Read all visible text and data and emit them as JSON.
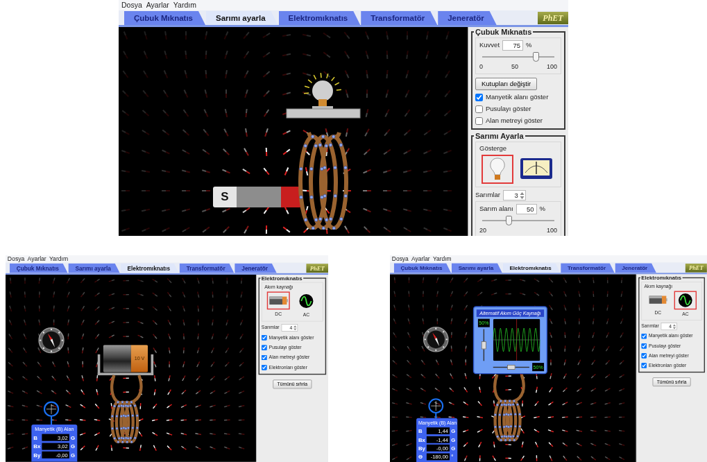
{
  "windows": [
    {
      "menu": [
        "Dosya",
        "Ayarlar",
        "Yardım"
      ],
      "tabs": [
        {
          "label": "Çubuk Mıknatıs",
          "selected": false
        },
        {
          "label": "Sarımı ayarla",
          "selected": true
        },
        {
          "label": "Elektromıknatıs",
          "selected": false
        },
        {
          "label": "Transformatör",
          "selected": false
        },
        {
          "label": "Jeneratör",
          "selected": false
        }
      ],
      "logo": "PhET",
      "scene": [
        {
          "kind": "field"
        },
        {
          "kind": "bulb"
        },
        {
          "kind": "magnet",
          "label": "S"
        },
        {
          "kind": "coil"
        }
      ],
      "panel": {
        "sections": [
          {
            "title": "Çubuk Mıknatıs",
            "controls": [
              {
                "kind": "slider",
                "label": "Kuvvet",
                "value": "75",
                "unit": "%",
                "level": 0.75,
                "ticks": [
                  "0",
                  "50",
                  "100"
                ]
              },
              {
                "kind": "button",
                "label": "Kutupları değiştir"
              },
              {
                "kind": "checkbox",
                "label": "Manyetik alanı göster",
                "checked": true
              },
              {
                "kind": "checkbox",
                "label": "Pusulayı göster",
                "checked": false
              },
              {
                "kind": "checkbox",
                "label": "Alan metreyi göster",
                "checked": false
              }
            ]
          },
          {
            "title": "Sarımı Ayarla",
            "controls": [
              {
                "kind": "choice",
                "label": "Gösterge",
                "options": [
                  {
                    "kind": "bulb",
                    "selected": true
                  },
                  {
                    "kind": "meter",
                    "selected": false
                  }
                ]
              },
              {
                "kind": "spinner",
                "label": "Sarımlar",
                "value": "3"
              },
              {
                "kind": "slider",
                "label": "Sarım alanı",
                "value": "50",
                "unit": "%",
                "level": 0.375,
                "ticks": [
                  "20",
                  "100"
                ]
              }
            ]
          }
        ]
      }
    },
    {
      "menu": [
        "Dosya",
        "Ayarlar",
        "Yardım"
      ],
      "tabs": [
        {
          "label": "Çubuk Mıknatıs",
          "selected": false
        },
        {
          "label": "Sarımı ayarla",
          "selected": false
        },
        {
          "label": "Elektromıknatıs",
          "selected": true
        },
        {
          "label": "Transformatör",
          "selected": false
        },
        {
          "label": "Jeneratör",
          "selected": false
        }
      ],
      "logo": "PhET",
      "scene": [
        {
          "kind": "field"
        },
        {
          "kind": "compass"
        },
        {
          "kind": "battery",
          "label": "10 V"
        },
        {
          "kind": "coil"
        },
        {
          "kind": "probe"
        },
        {
          "kind": "field_meter",
          "title": "Manyetik (B) Alan",
          "rows": [
            {
              "label": "B",
              "value": "3,02",
              "unit": "G"
            },
            {
              "label": "Bx",
              "value": "3,02",
              "unit": "G"
            },
            {
              "label": "By",
              "value": "-0,00",
              "unit": "G"
            }
          ]
        }
      ],
      "panel": {
        "sections": [
          {
            "title": "Elektromıknatıs",
            "controls": [
              {
                "kind": "choice",
                "label": "Akım kaynağı",
                "options": [
                  {
                    "kind": "dc",
                    "caption": "DC",
                    "selected": true
                  },
                  {
                    "kind": "ac",
                    "caption": "AC",
                    "selected": false
                  }
                ]
              },
              {
                "kind": "spinner",
                "label": "Sarımlar",
                "value": "4"
              },
              {
                "kind": "checkbox",
                "label": "Manyetik alanı göster",
                "checked": true
              },
              {
                "kind": "checkbox",
                "label": "Pusulayı göster",
                "checked": true
              },
              {
                "kind": "checkbox",
                "label": "Alan metreyi göster",
                "checked": true
              },
              {
                "kind": "checkbox",
                "label": "Elektronları göster",
                "checked": true
              }
            ]
          }
        ],
        "reset_button": "Tümünü sıfırla"
      }
    },
    {
      "menu": [
        "Dosya",
        "Ayarlar",
        "Yardım"
      ],
      "tabs": [
        {
          "label": "Çubuk Mıknatıs",
          "selected": false
        },
        {
          "label": "Sarımı ayarla",
          "selected": false
        },
        {
          "label": "Elektromıknatıs",
          "selected": true
        },
        {
          "label": "Transformatör",
          "selected": false
        },
        {
          "label": "Jeneratör",
          "selected": false
        }
      ],
      "logo": "PhET",
      "scene": [
        {
          "kind": "field"
        },
        {
          "kind": "compass"
        },
        {
          "kind": "ac_source",
          "title": "Alternatif Akım Güç Kaynağı",
          "amplitude": {
            "reading": "50%",
            "level": 0.5
          },
          "frequency": {
            "reading": "50%",
            "level": 0.5
          }
        },
        {
          "kind": "coil"
        },
        {
          "kind": "probe"
        },
        {
          "kind": "field_meter",
          "title": "Manyetik (B) Alan",
          "rows": [
            {
              "label": "B",
              "value": "1,44",
              "unit": "G"
            },
            {
              "label": "Bx",
              "value": "-1,44",
              "unit": "G"
            },
            {
              "label": "By",
              "value": "-0,00",
              "unit": "G"
            },
            {
              "label": "Θ",
              "value": "-180,00",
              "unit": "°"
            }
          ]
        }
      ],
      "panel": {
        "sections": [
          {
            "title": "Elektromıknatıs",
            "controls": [
              {
                "kind": "choice",
                "label": "Akım kaynağı",
                "options": [
                  {
                    "kind": "dc",
                    "caption": "DC",
                    "selected": false
                  },
                  {
                    "kind": "ac",
                    "caption": "AC",
                    "selected": true
                  }
                ]
              },
              {
                "kind": "spinner",
                "label": "Sarımlar",
                "value": "4"
              },
              {
                "kind": "checkbox",
                "label": "Manyetik alanı göster",
                "checked": true
              },
              {
                "kind": "checkbox",
                "label": "Pusulayı göster",
                "checked": true
              },
              {
                "kind": "checkbox",
                "label": "Alan metreyi göster",
                "checked": true
              },
              {
                "kind": "checkbox",
                "label": "Elektronları göster",
                "checked": true
              }
            ]
          }
        ],
        "reset_button": "Tümünü sıfırla"
      }
    }
  ]
}
